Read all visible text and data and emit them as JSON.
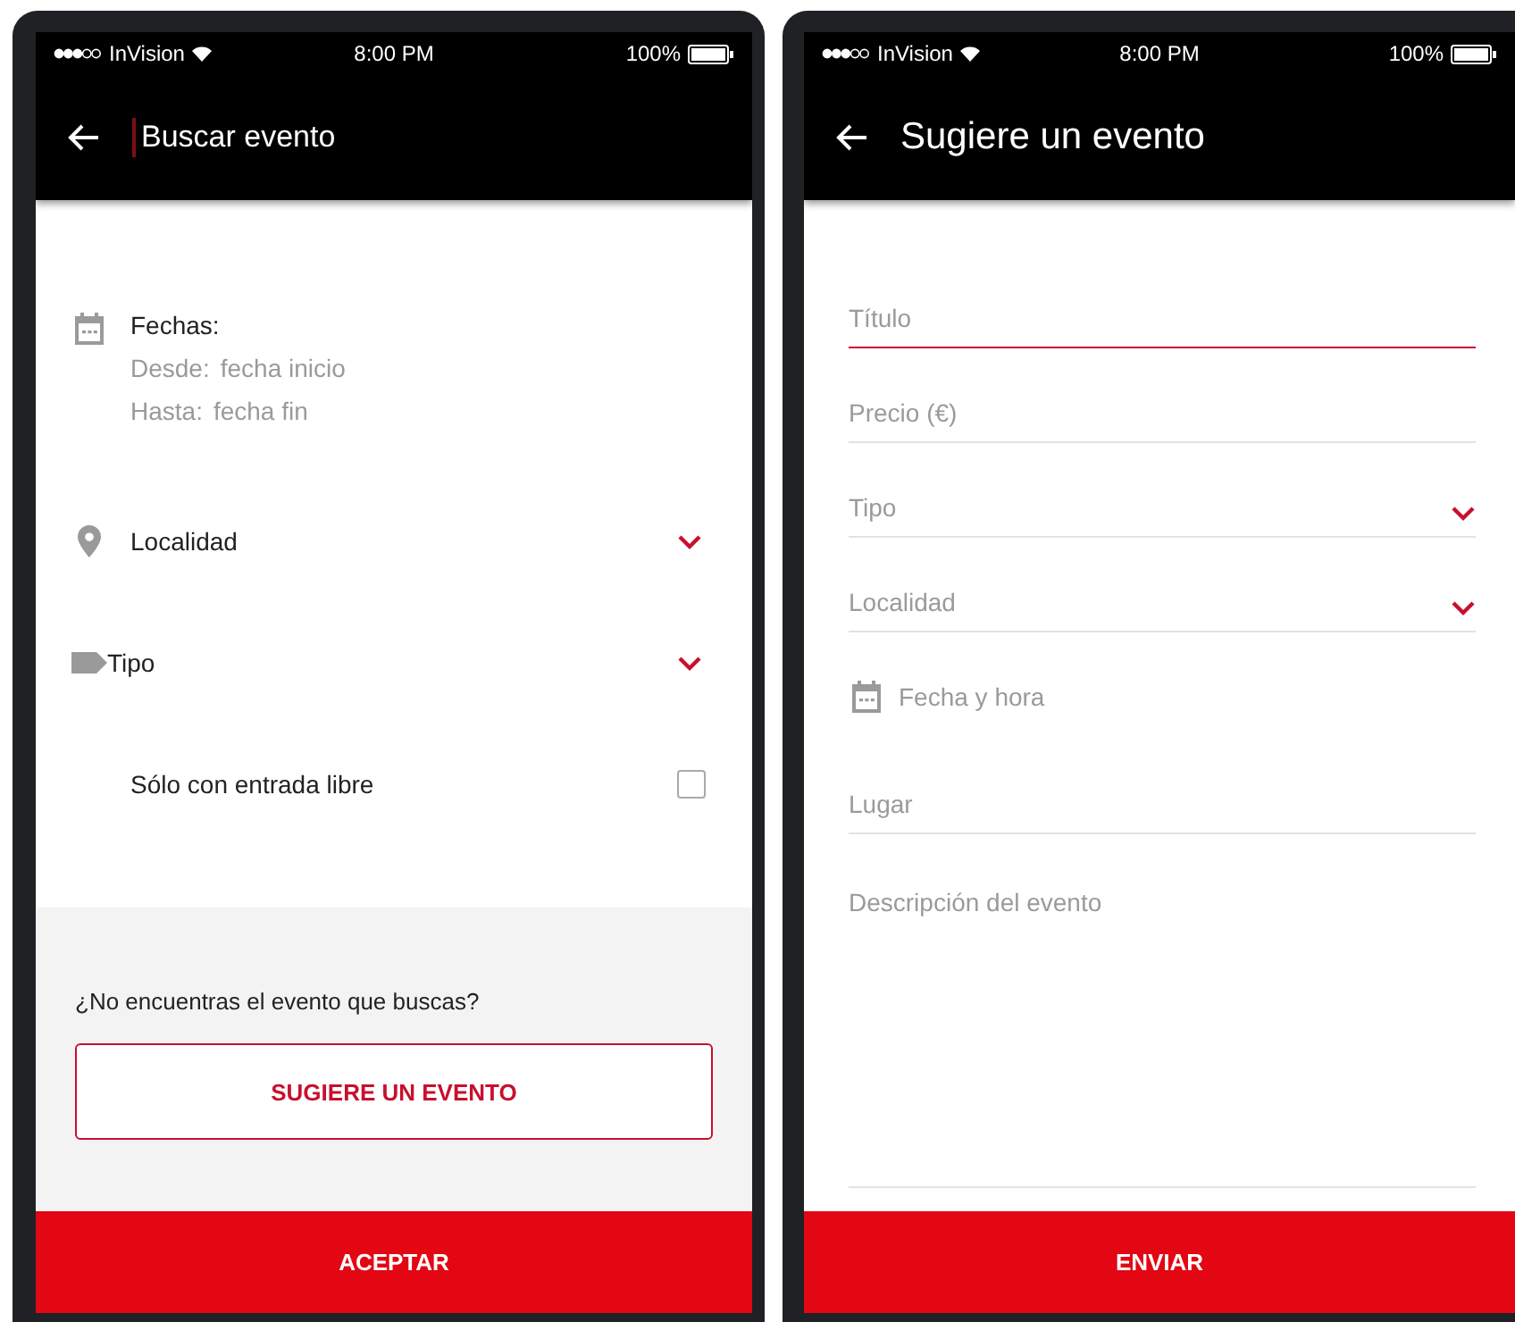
{
  "search_screen": {
    "status_bar": {
      "carrier": "InVision",
      "time": "8:00 PM",
      "battery": "100%"
    },
    "header": {
      "placeholder": "Buscar evento"
    },
    "dates": {
      "label": "Fechas:",
      "from_label": "Desde:",
      "from_placeholder": "fecha inicio",
      "to_label": "Hasta:",
      "to_placeholder": "fecha fin"
    },
    "location_select": {
      "label": "Localidad"
    },
    "type_select": {
      "label": "Tipo"
    },
    "free_entry": {
      "label": "Sólo con entrada libre",
      "checked": false
    },
    "prompt": "¿No encuentras el evento que buscas?",
    "suggest_button": "SUGIERE UN EVENTO",
    "accept_button": "ACEPTAR"
  },
  "suggest_screen": {
    "status_bar": {
      "carrier": "InVision",
      "time": "8:00 PM",
      "battery": "100%"
    },
    "title": "Sugiere un evento",
    "fields": [
      {
        "kind": "text",
        "placeholder": "Título",
        "focused": true
      },
      {
        "kind": "text",
        "placeholder": "Precio (€)",
        "focused": false
      },
      {
        "kind": "select",
        "placeholder": "Tipo",
        "focused": false
      },
      {
        "kind": "select",
        "placeholder": "Localidad",
        "focused": false
      },
      {
        "kind": "date",
        "placeholder": "Fecha y hora",
        "focused": false
      },
      {
        "kind": "text",
        "placeholder": "Lugar",
        "focused": false
      },
      {
        "kind": "textarea",
        "placeholder": "Descripción del evento",
        "focused": false
      }
    ],
    "submit_button": "ENVIAR"
  }
}
